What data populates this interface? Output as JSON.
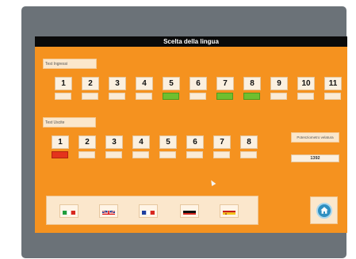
{
  "title": "Scelta della lingua",
  "group1": {
    "label": "Test Ingressi",
    "keys": [
      "1",
      "2",
      "3",
      "4",
      "5",
      "6",
      "7",
      "8",
      "9",
      "10",
      "11"
    ],
    "states": [
      "off",
      "off",
      "off",
      "off",
      "on",
      "off",
      "on",
      "on",
      "off",
      "off",
      "off"
    ]
  },
  "group2": {
    "label": "Test Uscite",
    "keys": [
      "1",
      "2",
      "3",
      "4",
      "5",
      "6",
      "7",
      "8"
    ],
    "states": [
      "alarm",
      "off",
      "off",
      "off",
      "off",
      "off",
      "off",
      "off"
    ]
  },
  "counter": {
    "label": "Potenziometro velatura",
    "value": "1392"
  },
  "languages": [
    {
      "name": "italian",
      "icon": "italy-flag-icon"
    },
    {
      "name": "english",
      "icon": "uk-flag-icon"
    },
    {
      "name": "french",
      "icon": "france-flag-icon"
    },
    {
      "name": "german",
      "icon": "germany-flag-icon"
    },
    {
      "name": "spanish",
      "icon": "spain-flag-icon"
    }
  ],
  "home_icon": "home-icon",
  "colors": {
    "screen_bg": "#f5921f",
    "title_bg": "#0a0a0a",
    "indicator_on": "#6fbf2f",
    "indicator_alarm": "#e4331c",
    "device_bezel": "#6b7278"
  }
}
